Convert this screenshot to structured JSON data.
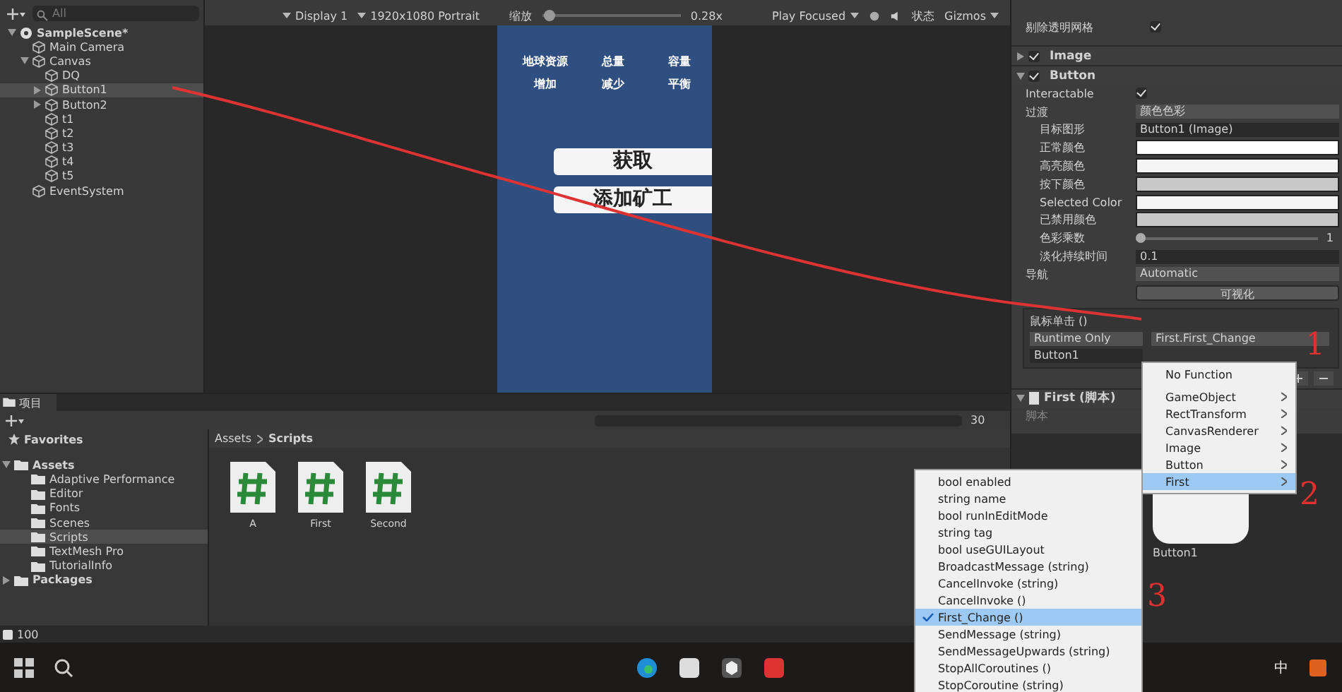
{
  "hierarchy": {
    "search": {
      "placeholder": "All"
    },
    "tree": [
      {
        "label": "SampleScene*",
        "kind": "scene",
        "selected": false,
        "expanded": true,
        "children": [
          {
            "label": "Main Camera",
            "kind": "object",
            "selected": false
          },
          {
            "label": "Canvas",
            "kind": "object",
            "selected": false,
            "expanded": true,
            "children": [
              {
                "label": "DQ",
                "kind": "object",
                "selected": false
              },
              {
                "label": "Button1",
                "kind": "object",
                "selected": true,
                "expanded": false
              },
              {
                "label": "Button2",
                "kind": "object",
                "selected": false,
                "expanded": false
              },
              {
                "label": "t1",
                "kind": "object",
                "selected": false
              },
              {
                "label": "t2",
                "kind": "object",
                "selected": false
              },
              {
                "label": "t3",
                "kind": "object",
                "selected": false
              },
              {
                "label": "t4",
                "kind": "object",
                "selected": false
              },
              {
                "label": "t5",
                "kind": "object",
                "selected": false
              }
            ]
          },
          {
            "label": "EventSystem",
            "kind": "object",
            "selected": false
          }
        ]
      }
    ]
  },
  "game_toolbar": {
    "display": "Display 1",
    "resolution": "1920x1080 Portrait",
    "scale_label": "缩放",
    "scale": {
      "level": 0.02
    },
    "scale_reading": "0.28x",
    "play_mode": "Play Focused",
    "stats": "状态",
    "gizmos": "Gizmos"
  },
  "game_view": {
    "labels": [
      "地球资源",
      "总量",
      "容量",
      "增加",
      "减少",
      "平衡"
    ],
    "buttons": [
      "获取",
      "添加矿工"
    ]
  },
  "inspector": {
    "top_row": {
      "label": "剔除透明网格",
      "checked": true
    },
    "components": [
      {
        "name": "Image",
        "enabled": true,
        "expanded": false
      },
      {
        "name": "Button",
        "enabled": true,
        "expanded": true
      }
    ],
    "properties": [
      {
        "label": "Interactable",
        "kind": "check",
        "checked": true
      },
      {
        "label": "过渡",
        "kind": "dropdown",
        "value": "颜色色彩",
        "children": [
          {
            "label": "目标图形",
            "kind": "object",
            "value": "Button1 (Image)"
          },
          {
            "label": "正常颜色",
            "kind": "color",
            "color": "#ffffff"
          },
          {
            "label": "高亮颜色",
            "kind": "color",
            "color": "#f5f5f5"
          },
          {
            "label": "按下颜色",
            "kind": "color",
            "color": "#c8c8c8"
          },
          {
            "label": "Selected Color",
            "kind": "color",
            "color": "#f5f5f5"
          },
          {
            "label": "已禁用颜色",
            "kind": "color",
            "color": "#c8c8c8"
          },
          {
            "label": "色彩乘数",
            "kind": "slider",
            "level": 0,
            "reading": "1"
          },
          {
            "label": "淡化持续时间",
            "kind": "text",
            "value": "0.1"
          }
        ]
      },
      {
        "label": "导航",
        "kind": "dropdown",
        "value": "Automatic"
      },
      {
        "kind": "button",
        "value": "可视化"
      }
    ],
    "event": {
      "title": "鼠标单击 ()",
      "mode": "Runtime Only",
      "function": "First.First_Change",
      "target": "Button1"
    },
    "script_component": {
      "name": "First (脚本)",
      "script_label": "脚本"
    },
    "preview_label": "Button1"
  },
  "project": {
    "tab": "项目",
    "favorites": "Favorites",
    "tree": [
      {
        "label": "Assets",
        "selected": false,
        "expanded": true,
        "children": [
          {
            "label": "Adaptive Performance",
            "selected": false
          },
          {
            "label": "Editor",
            "selected": false
          },
          {
            "label": "Fonts",
            "selected": false
          },
          {
            "label": "Scenes",
            "selected": false
          },
          {
            "label": "Scripts",
            "selected": true
          },
          {
            "label": "TextMesh Pro",
            "selected": false
          },
          {
            "label": "TutorialInfo",
            "selected": false
          }
        ]
      },
      {
        "label": "Packages",
        "selected": false,
        "expanded": false
      }
    ],
    "breadcrumb": [
      "Assets",
      "Scripts"
    ],
    "files": [
      "A",
      "First",
      "Second"
    ],
    "hidden_count": "30"
  },
  "status_bar": {
    "count": "100"
  },
  "component_menu": [
    {
      "label": "No Function",
      "submenu": false,
      "selected": false
    },
    {
      "label": "GameObject",
      "submenu": true,
      "selected": false
    },
    {
      "label": "RectTransform",
      "submenu": true,
      "selected": false
    },
    {
      "label": "CanvasRenderer",
      "submenu": true,
      "selected": false
    },
    {
      "label": "Image",
      "submenu": true,
      "selected": false
    },
    {
      "label": "Button",
      "submenu": true,
      "selected": false
    },
    {
      "label": "First",
      "submenu": true,
      "selected": true
    }
  ],
  "function_menu": [
    {
      "label": "bool enabled",
      "selected": false
    },
    {
      "label": "string name",
      "selected": false
    },
    {
      "label": "bool runInEditMode",
      "selected": false
    },
    {
      "label": "string tag",
      "selected": false
    },
    {
      "label": "bool useGUILayout",
      "selected": false
    },
    {
      "label": "BroadcastMessage (string)",
      "selected": false
    },
    {
      "label": "CancelInvoke (string)",
      "selected": false
    },
    {
      "label": "CancelInvoke ()",
      "selected": false
    },
    {
      "label": "First_Change ()",
      "selected": true
    },
    {
      "label": "SendMessage (string)",
      "selected": false
    },
    {
      "label": "SendMessageUpwards (string)",
      "selected": false
    },
    {
      "label": "StopAllCoroutines ()",
      "selected": false
    },
    {
      "label": "StopCoroutine (string)",
      "selected": false
    }
  ],
  "annotations": [
    "1",
    "2",
    "3"
  ],
  "taskbar": {
    "ime": "中"
  }
}
